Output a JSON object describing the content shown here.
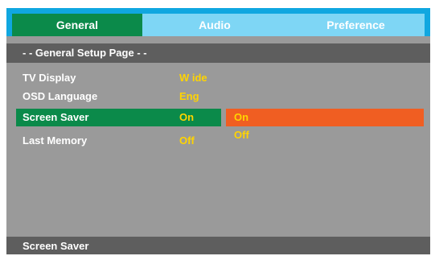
{
  "tabs": [
    {
      "label": "General",
      "active": true
    },
    {
      "label": "Audio",
      "active": false
    },
    {
      "label": "Preference",
      "active": false
    }
  ],
  "page_title": "- - General Setup Page - -",
  "settings": [
    {
      "label": "TV Display",
      "value": "W ide"
    },
    {
      "label": "OSD Language",
      "value": "Eng"
    },
    {
      "label": "Screen Saver",
      "value": "On",
      "selected": true
    },
    {
      "label": "Last Memory",
      "value": "Off"
    }
  ],
  "options": [
    {
      "label": "On",
      "highlighted": true
    },
    {
      "label": "Off",
      "highlighted": false
    }
  ],
  "footer": {
    "help_text": "Screen Saver"
  },
  "colors": {
    "tab_bar": "#10a7e0",
    "tab_inactive": "#7ed6f5",
    "selection_green": "#0b8a4a",
    "option_highlight": "#f05e22",
    "value_yellow": "#ffd400",
    "panel_gray": "#9a9a9a",
    "header_gray": "#5e5e5e"
  }
}
